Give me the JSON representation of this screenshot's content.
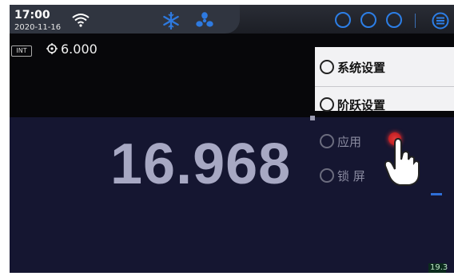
{
  "status": {
    "time": "17:00",
    "date": "2020-11-16"
  },
  "readout": {
    "input_mode": "INT",
    "setpoint": "6.000",
    "value": "16.968"
  },
  "menu": {
    "items": [
      {
        "label": "系统设置",
        "icon": "settings-icon"
      },
      {
        "label": "阶跃设置",
        "icon": "gauge-icon"
      },
      {
        "label": "应用",
        "icon": "apps-icon"
      },
      {
        "label": "锁 屏",
        "icon": "lock-icon"
      }
    ]
  },
  "corner_value": "19.3",
  "colors": {
    "accent": "#2c7ee6",
    "panel": "#151631",
    "reading": "#a7a8c3"
  }
}
